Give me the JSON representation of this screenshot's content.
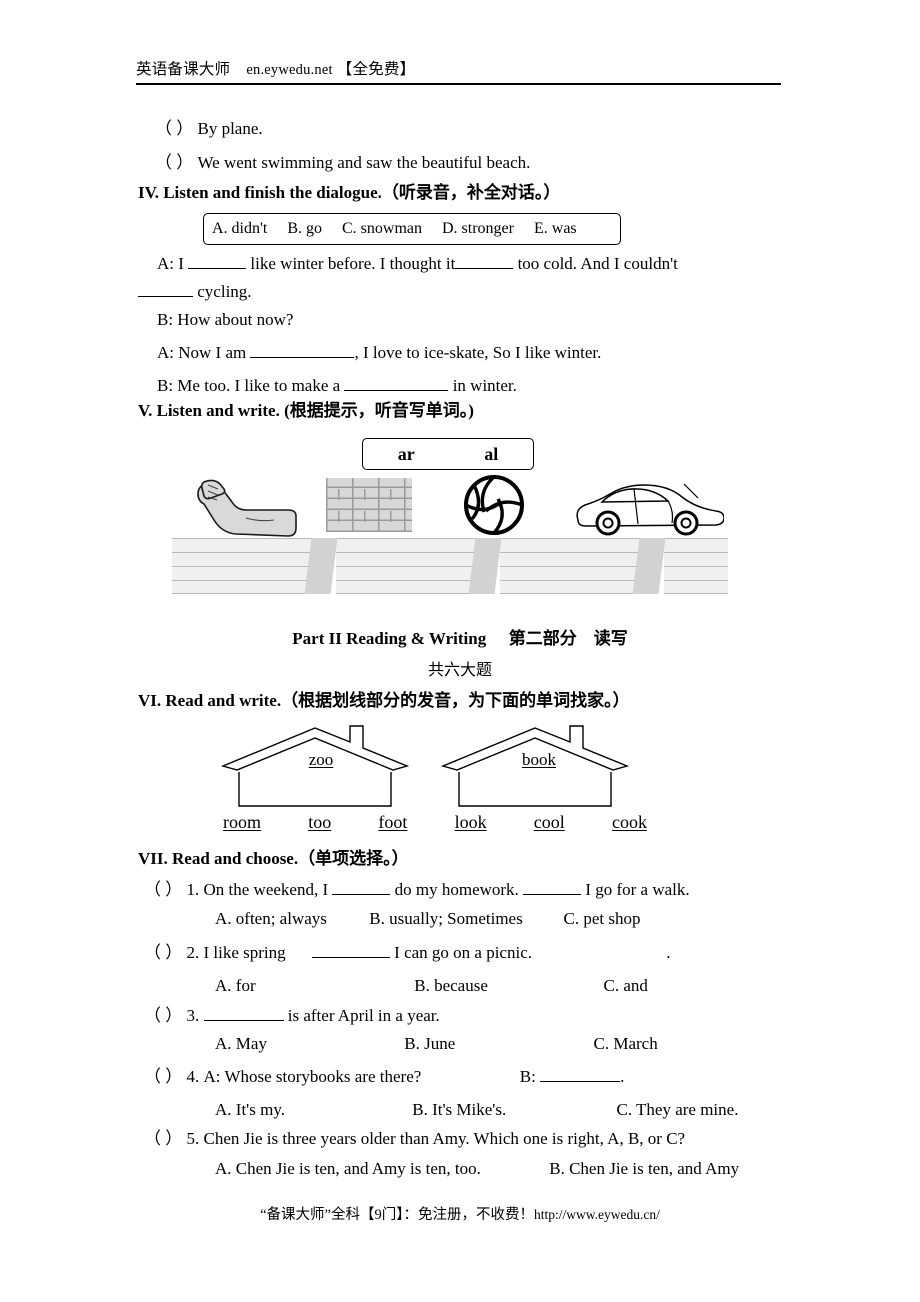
{
  "header": {
    "brand": "英语备课大师",
    "site": "en.eywedu.net",
    "tag": "【全免费】"
  },
  "listening_leftover": {
    "item1_paren": "（    ）",
    "item1_text": "By plane.",
    "item2_paren": "（    ）",
    "item2_text": "We went swimming and saw the beautiful beach."
  },
  "section_iv": {
    "heading": "IV. Listen and finish the dialogue.",
    "heading_cn": "（听录音，补全对话。）",
    "wordbank": [
      "A. didn't",
      "B. go",
      "C. snowman",
      "D. stronger",
      "E. was"
    ],
    "dialogue": {
      "a1_part1": "A: I",
      "a1_part2": "like winter before. I thought it",
      "a1_part3": "too cold. And I couldn't",
      "a1_part4": "cycling.",
      "b1": "B: How about now?",
      "a2_part1": "A: Now I am",
      "a2_part2": ", I love to ice-skate, So I like winter.",
      "b2_part1": "B: Me too. I like to make a",
      "b2_part2": "in winter."
    }
  },
  "section_v": {
    "heading": "V. Listen and write.",
    "heading_cn": "(根据提示，听音写单词。)",
    "phonics_box": [
      "ar",
      "al"
    ],
    "pictures": [
      "arm-muscle-picture",
      "brick-wall-picture",
      "volleyball-picture",
      "car-picture"
    ]
  },
  "part2": {
    "title_en": "Part II    Reading & Writing",
    "title_cn": "第二部分　读写",
    "subtitle": "共六大题"
  },
  "section_vi": {
    "heading": "VI. Read and write.",
    "heading_cn": "（根据划线部分的发音，为下面的单词找家。）",
    "house_left_label": "zoo",
    "house_right_label": "book",
    "words": [
      "room",
      "too",
      "foot",
      "look",
      "cool",
      "cook"
    ]
  },
  "section_vii": {
    "heading": "VII. Read and choose.",
    "heading_cn": "（单项选择。）",
    "questions": [
      {
        "paren": "（    ）",
        "number": "1.",
        "stem_part1": "On the weekend, I",
        "stem_part2": "do my homework.",
        "stem_part3": "I go for a walk.",
        "options": [
          "A. often; always",
          "B. usually; Sometimes",
          "C. pet shop"
        ]
      },
      {
        "paren": "（    ）",
        "number": "2.",
        "stem_part1": "I like spring",
        "stem_part2": "I can go on a picnic.",
        "stem_trailing": ".",
        "options": [
          "A. for",
          "B. because",
          "C. and"
        ]
      },
      {
        "paren": "（    ）",
        "number": "3.",
        "stem_part1": "",
        "stem_part2": "is after April in a year.",
        "options": [
          "A. May",
          "B. June",
          "C. March"
        ]
      },
      {
        "paren": "（    ）",
        "number": "4.",
        "stem_part1": "A: Whose storybooks are there?",
        "stem_part2": "B:",
        "stem_trailing": ".",
        "options": [
          "A. It's my.",
          "B. It's Mike's.",
          "C. They are mine."
        ]
      },
      {
        "paren": "（    ）",
        "number": "5.",
        "stem_part1": "Chen Jie is three years older than Amy. Which one is right, A, B, or C?",
        "options": [
          "A. Chen Jie is ten, and Amy is ten, too.",
          "B. Chen Jie is ten, and Amy"
        ]
      }
    ]
  },
  "footer": {
    "text": "“备课大师”全科【9门】：免注册，不收费！",
    "url": "http://www.eywedu.cn/"
  }
}
